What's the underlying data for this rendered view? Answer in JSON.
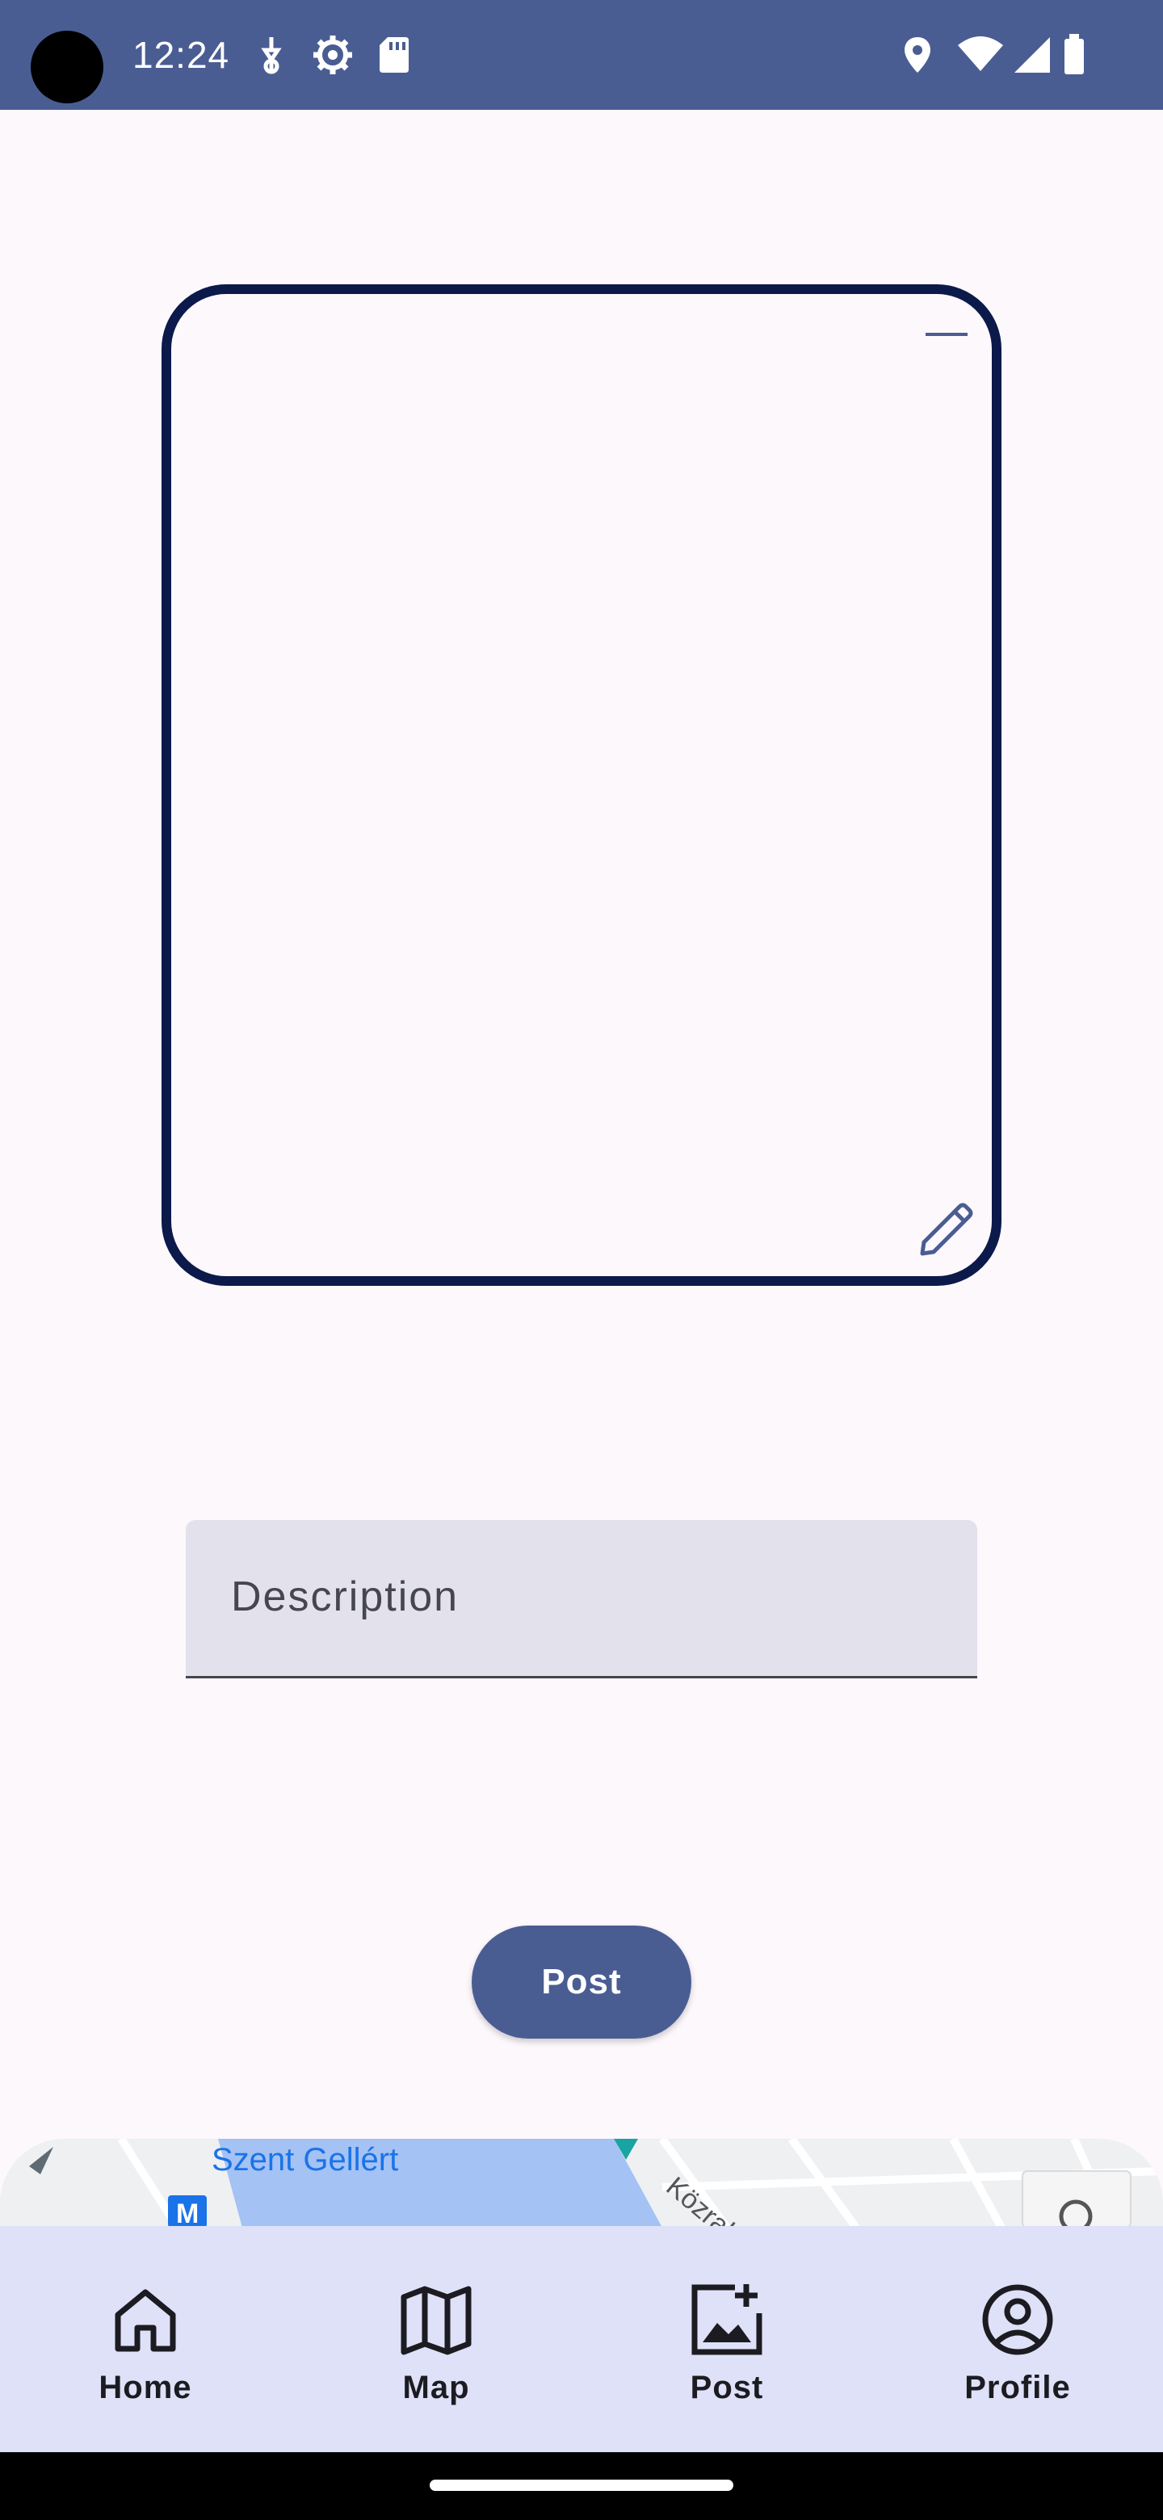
{
  "status_bar": {
    "time": "12:24",
    "background": "#4a5d93",
    "left_icons": [
      "usb-debug-icon",
      "settings-icon",
      "sd-card-icon"
    ],
    "right_icons": [
      "location-icon",
      "wifi-icon",
      "signal-icon",
      "battery-icon"
    ]
  },
  "image_frame": {
    "border_color": "#0b1a4a",
    "top_icon": "remove-icon",
    "bottom_icon": "edit-icon"
  },
  "description": {
    "placeholder": "Description",
    "value": ""
  },
  "post_button": {
    "label": "Post",
    "color": "#4a5d93"
  },
  "map_preview": {
    "labels": [
      "Szent Gellért",
      "Közraktár"
    ]
  },
  "bottom_nav": {
    "items": [
      {
        "label": "Home",
        "icon": "home-icon"
      },
      {
        "label": "Map",
        "icon": "map-icon"
      },
      {
        "label": "Post",
        "icon": "add-photo-icon"
      },
      {
        "label": "Profile",
        "icon": "account-circle-icon"
      }
    ],
    "background": "#dee1f7"
  }
}
